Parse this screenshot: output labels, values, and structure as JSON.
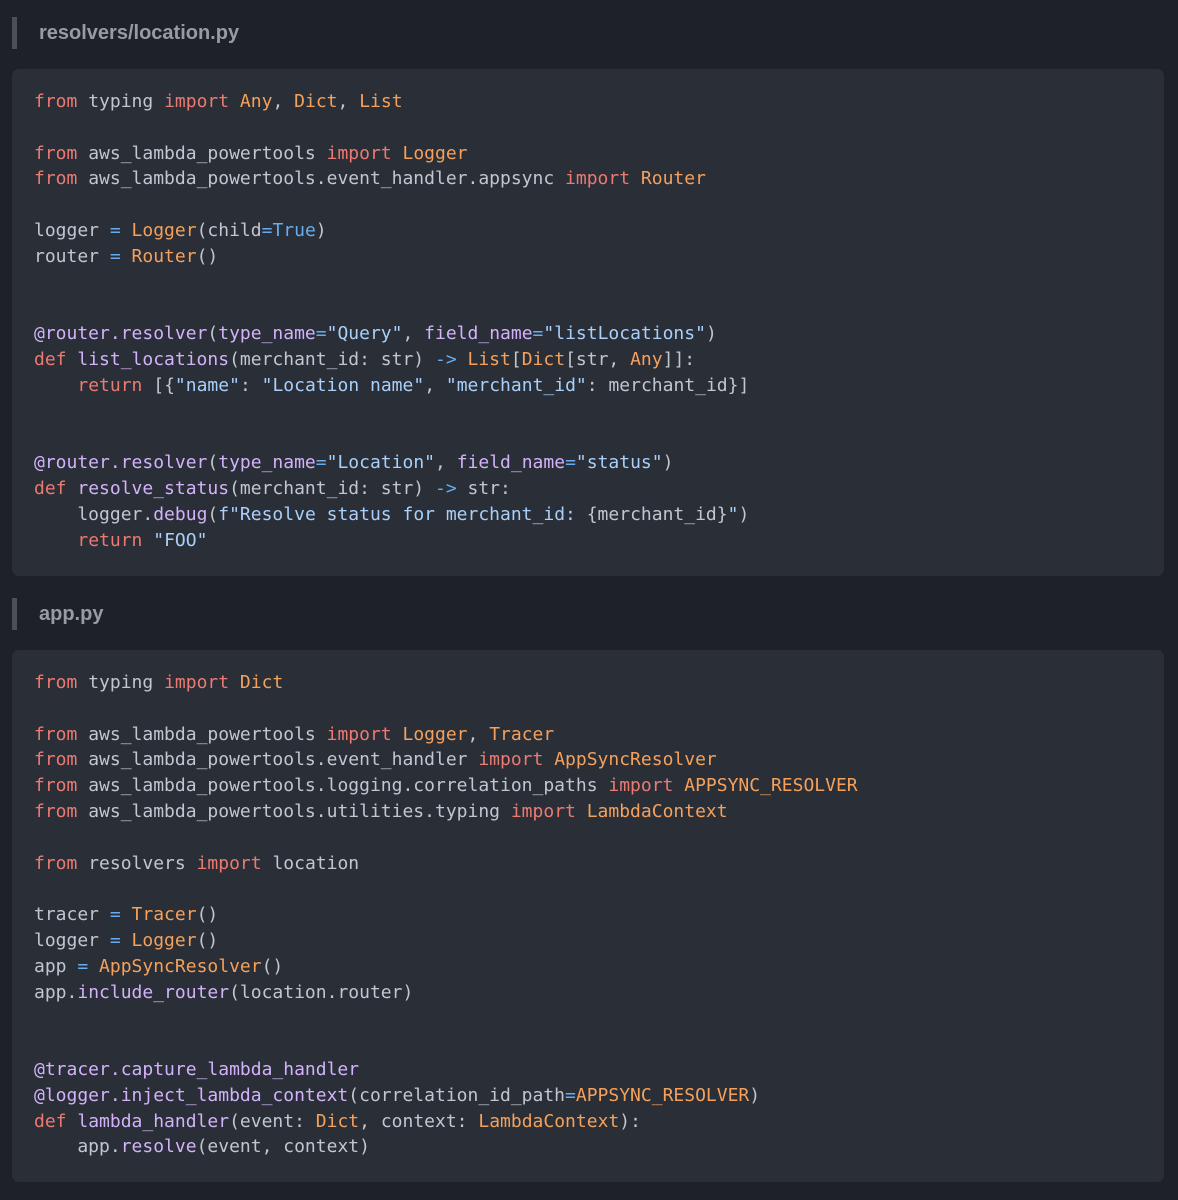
{
  "colors": {
    "background": "#1e2128",
    "code_background": "#2a2e37",
    "keyword": "#ed7a72",
    "class": "#f5a15c",
    "operator": "#67adef",
    "string": "#a8d0fb",
    "decorator": "#d2b3fb",
    "plain": "#c1c6cf",
    "header_text": "#969ba4"
  },
  "files": [
    {
      "name": "resolvers/location.py",
      "lines": [
        [
          [
            "kw",
            "from"
          ],
          [
            "plain",
            " typing "
          ],
          [
            "kw",
            "import"
          ],
          [
            "cls",
            " Any"
          ],
          [
            "plain",
            ", "
          ],
          [
            "cls",
            "Dict"
          ],
          [
            "plain",
            ", "
          ],
          [
            "cls",
            "List"
          ]
        ],
        [],
        [
          [
            "kw",
            "from"
          ],
          [
            "plain",
            " aws_lambda_powertools "
          ],
          [
            "kw",
            "import"
          ],
          [
            "cls",
            " Logger"
          ]
        ],
        [
          [
            "kw",
            "from"
          ],
          [
            "plain",
            " aws_lambda_powertools.event_handler.appsync "
          ],
          [
            "kw",
            "import"
          ],
          [
            "cls",
            " Router"
          ]
        ],
        [],
        [
          [
            "plain",
            "logger "
          ],
          [
            "op",
            "="
          ],
          [
            "cls",
            " Logger"
          ],
          [
            "plain",
            "(child"
          ],
          [
            "op",
            "="
          ],
          [
            "op",
            "True"
          ],
          [
            "plain",
            ")"
          ]
        ],
        [
          [
            "plain",
            "router "
          ],
          [
            "op",
            "="
          ],
          [
            "cls",
            " Router"
          ],
          [
            "plain",
            "()"
          ]
        ],
        [],
        [],
        [
          [
            "dec",
            "@router.resolver"
          ],
          [
            "plain",
            "("
          ],
          [
            "dec",
            "type_name"
          ],
          [
            "op",
            "="
          ],
          [
            "str",
            "\"Query\""
          ],
          [
            "plain",
            ", "
          ],
          [
            "dec",
            "field_name"
          ],
          [
            "op",
            "="
          ],
          [
            "str",
            "\"listLocations\""
          ],
          [
            "plain",
            ")"
          ]
        ],
        [
          [
            "kw",
            "def"
          ],
          [
            "fn",
            " list_locations"
          ],
          [
            "plain",
            "(merchant_id: str) "
          ],
          [
            "op",
            "->"
          ],
          [
            "cls",
            " List"
          ],
          [
            "plain",
            "["
          ],
          [
            "cls",
            "Dict"
          ],
          [
            "plain",
            "[str, "
          ],
          [
            "cls",
            "Any"
          ],
          [
            "plain",
            "]]:"
          ]
        ],
        [
          [
            "plain",
            "    "
          ],
          [
            "kw",
            "return"
          ],
          [
            "plain",
            " [{"
          ],
          [
            "str",
            "\"name\""
          ],
          [
            "plain",
            ": "
          ],
          [
            "str",
            "\"Location name\""
          ],
          [
            "plain",
            ", "
          ],
          [
            "str",
            "\"merchant_id\""
          ],
          [
            "plain",
            ": merchant_id}]"
          ]
        ],
        [],
        [],
        [
          [
            "dec",
            "@router.resolver"
          ],
          [
            "plain",
            "("
          ],
          [
            "dec",
            "type_name"
          ],
          [
            "op",
            "="
          ],
          [
            "str",
            "\"Location\""
          ],
          [
            "plain",
            ", "
          ],
          [
            "dec",
            "field_name"
          ],
          [
            "op",
            "="
          ],
          [
            "str",
            "\"status\""
          ],
          [
            "plain",
            ")"
          ]
        ],
        [
          [
            "kw",
            "def"
          ],
          [
            "fn",
            " resolve_status"
          ],
          [
            "plain",
            "(merchant_id: str) "
          ],
          [
            "op",
            "->"
          ],
          [
            "plain",
            " str:"
          ]
        ],
        [
          [
            "plain",
            "    logger."
          ],
          [
            "fn",
            "debug"
          ],
          [
            "plain",
            "("
          ],
          [
            "str",
            "f\"Resolve status for merchant_id: "
          ],
          [
            "plain",
            "{merchant_id}"
          ],
          [
            "str",
            "\""
          ],
          [
            "plain",
            ")"
          ]
        ],
        [
          [
            "plain",
            "    "
          ],
          [
            "kw",
            "return"
          ],
          [
            "str",
            " \"FOO\""
          ]
        ]
      ]
    },
    {
      "name": "app.py",
      "lines": [
        [
          [
            "kw",
            "from"
          ],
          [
            "plain",
            " typing "
          ],
          [
            "kw",
            "import"
          ],
          [
            "cls",
            " Dict"
          ]
        ],
        [],
        [
          [
            "kw",
            "from"
          ],
          [
            "plain",
            " aws_lambda_powertools "
          ],
          [
            "kw",
            "import"
          ],
          [
            "cls",
            " Logger"
          ],
          [
            "plain",
            ", "
          ],
          [
            "cls",
            "Tracer"
          ]
        ],
        [
          [
            "kw",
            "from"
          ],
          [
            "plain",
            " aws_lambda_powertools.event_handler "
          ],
          [
            "kw",
            "import"
          ],
          [
            "cls",
            " AppSyncResolver"
          ]
        ],
        [
          [
            "kw",
            "from"
          ],
          [
            "plain",
            " aws_lambda_powertools.logging.correlation_paths "
          ],
          [
            "kw",
            "import"
          ],
          [
            "cls",
            " APPSYNC_RESOLVER"
          ]
        ],
        [
          [
            "kw",
            "from"
          ],
          [
            "plain",
            " aws_lambda_powertools.utilities.typing "
          ],
          [
            "kw",
            "import"
          ],
          [
            "cls",
            " LambdaContext"
          ]
        ],
        [],
        [
          [
            "kw",
            "from"
          ],
          [
            "plain",
            " resolvers "
          ],
          [
            "kw",
            "import"
          ],
          [
            "plain",
            " location"
          ]
        ],
        [],
        [
          [
            "plain",
            "tracer "
          ],
          [
            "op",
            "="
          ],
          [
            "cls",
            " Tracer"
          ],
          [
            "plain",
            "()"
          ]
        ],
        [
          [
            "plain",
            "logger "
          ],
          [
            "op",
            "="
          ],
          [
            "cls",
            " Logger"
          ],
          [
            "plain",
            "()"
          ]
        ],
        [
          [
            "plain",
            "app "
          ],
          [
            "op",
            "="
          ],
          [
            "cls",
            " AppSyncResolver"
          ],
          [
            "plain",
            "()"
          ]
        ],
        [
          [
            "plain",
            "app."
          ],
          [
            "fn",
            "include_router"
          ],
          [
            "plain",
            "(location.router)"
          ]
        ],
        [],
        [],
        [
          [
            "dec",
            "@tracer.capture_lambda_handler"
          ]
        ],
        [
          [
            "dec",
            "@logger.inject_lambda_context"
          ],
          [
            "plain",
            "(correlation_id_path"
          ],
          [
            "op",
            "="
          ],
          [
            "cls",
            "APPSYNC_RESOLVER"
          ],
          [
            "plain",
            ")"
          ]
        ],
        [
          [
            "kw",
            "def"
          ],
          [
            "fn",
            " lambda_handler"
          ],
          [
            "plain",
            "(event: "
          ],
          [
            "cls",
            "Dict"
          ],
          [
            "plain",
            ", context: "
          ],
          [
            "cls",
            "LambdaContext"
          ],
          [
            "plain",
            "):"
          ]
        ],
        [
          [
            "plain",
            "    app."
          ],
          [
            "fn",
            "resolve"
          ],
          [
            "plain",
            "(event, context)"
          ]
        ]
      ]
    }
  ]
}
